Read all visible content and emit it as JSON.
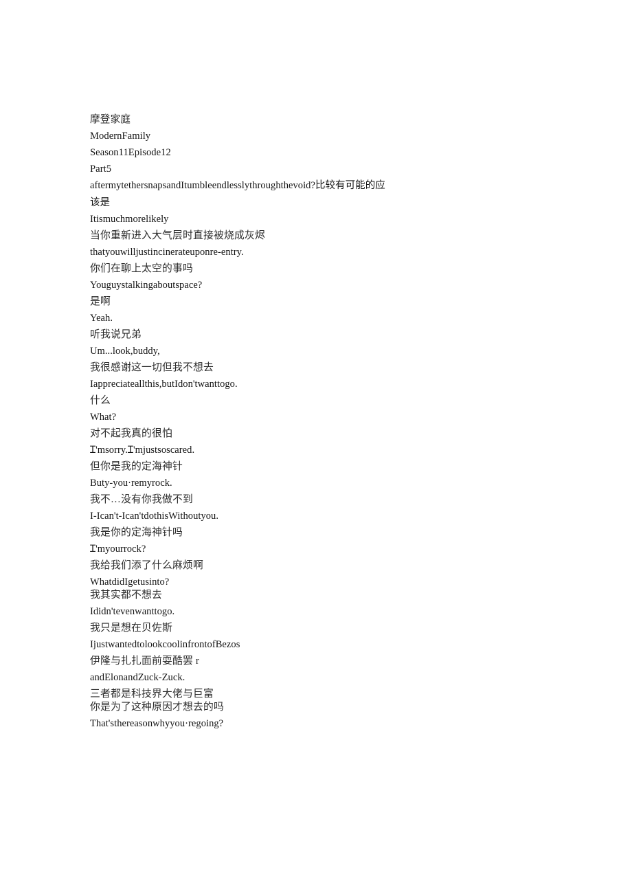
{
  "document": {
    "type": "subtitle-transcript",
    "background_color": "#ffffff",
    "text_color": "#1a1a1a",
    "header": {
      "title_zh": "摩登家庭",
      "title_en": "ModernFamily",
      "season_episode": "Season11Episode12",
      "part": "Part5"
    },
    "lines": [
      {
        "id": "l1",
        "lang": "mixed",
        "wrap": true,
        "text": "aftermytethersnapsandItumbleendlesslythroughthevoid?比较有可能的应该是"
      },
      {
        "id": "l2",
        "lang": "en",
        "text": "Itismuchmorelikely"
      },
      {
        "id": "l3",
        "lang": "zh",
        "text": "当你重新进入大气层时直接被烧成灰烬"
      },
      {
        "id": "l4",
        "lang": "en",
        "text": "thatyouwilljustincinerateuponre-entry."
      },
      {
        "id": "l5",
        "lang": "zh",
        "text": "你们在聊上太空的事吗"
      },
      {
        "id": "l6",
        "lang": "en",
        "text": "Youguystalkingaboutspace?"
      },
      {
        "id": "l7",
        "lang": "zh",
        "text": "是啊"
      },
      {
        "id": "l8",
        "lang": "en",
        "text": "Yeah."
      },
      {
        "id": "l9",
        "lang": "zh",
        "text": "听我说兄弟"
      },
      {
        "id": "l10",
        "lang": "en",
        "text": "Um...look,buddy,"
      },
      {
        "id": "l11",
        "lang": "zh",
        "text": "我很感谢这一切但我不想去"
      },
      {
        "id": "l12",
        "lang": "en",
        "text": "Iappreciateallthis,butIdon'twanttogo."
      },
      {
        "id": "l13",
        "lang": "zh",
        "text": "什么"
      },
      {
        "id": "l14",
        "lang": "en",
        "text": "What?"
      },
      {
        "id": "l15",
        "lang": "zh",
        "text": "对不起我真的很怕"
      },
      {
        "id": "l16",
        "lang": "en",
        "text": "Ɪ'msorry.Ɪ'mjustsoscared."
      },
      {
        "id": "l17",
        "lang": "zh",
        "text": "但你是我的定海神针"
      },
      {
        "id": "l18",
        "lang": "en",
        "text": "Buty-you·remyrock."
      },
      {
        "id": "l19",
        "lang": "zh",
        "text": "我不…没有你我做不到"
      },
      {
        "id": "l20",
        "lang": "en",
        "text": "I-Ican't-Ican'tdothisWithoutyou."
      },
      {
        "id": "l21",
        "lang": "zh",
        "text": "我是你的定海神针吗"
      },
      {
        "id": "l22",
        "lang": "en",
        "text": "Ɪ'myourrock?"
      },
      {
        "id": "l23",
        "lang": "zh",
        "text": "我给我们添了什么麻烦啊"
      },
      {
        "id": "l24",
        "lang": "en",
        "text": "WhatdidIgetusinto?"
      },
      {
        "id": "l25",
        "lang": "zh",
        "tight": true,
        "text": "我其实都不想去"
      },
      {
        "id": "l26",
        "lang": "en",
        "text": "Ididn'tevenwanttogo."
      },
      {
        "id": "l27",
        "lang": "zh",
        "text": "我只是想在贝佐斯"
      },
      {
        "id": "l28",
        "lang": "en",
        "text": "IjustwantedtolookcoolinfrontofBezos"
      },
      {
        "id": "l29",
        "lang": "zh",
        "text": "伊隆与扎扎面前耍酷罢 r"
      },
      {
        "id": "l30",
        "lang": "en",
        "text": "andElonandZuck-Zuck."
      },
      {
        "id": "l31",
        "lang": "zh",
        "text": "三者都是科技界大佬与巨富"
      },
      {
        "id": "l32",
        "lang": "zh",
        "tight": true,
        "text": "你是为了这种原因才想去的吗"
      },
      {
        "id": "l33",
        "lang": "en",
        "text": "That'sthereasonwhyyou·regoing?"
      }
    ]
  }
}
